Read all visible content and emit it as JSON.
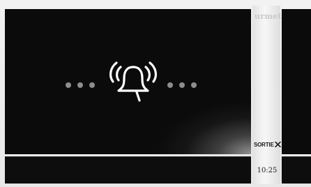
{
  "panel": {
    "brand_text": "urmet",
    "exit_label": "SORTIE",
    "exit_icon": "close-x-icon",
    "time": "10:25"
  },
  "call_screen": {
    "status_icon": "ringing-bell-icon",
    "left_dots": 3,
    "right_dots": 3
  },
  "colors": {
    "screen_bg": "#0b0b0b",
    "bezel": "#f2f2f2",
    "dot": "#8d8d8d",
    "icon": "#ffffff"
  }
}
